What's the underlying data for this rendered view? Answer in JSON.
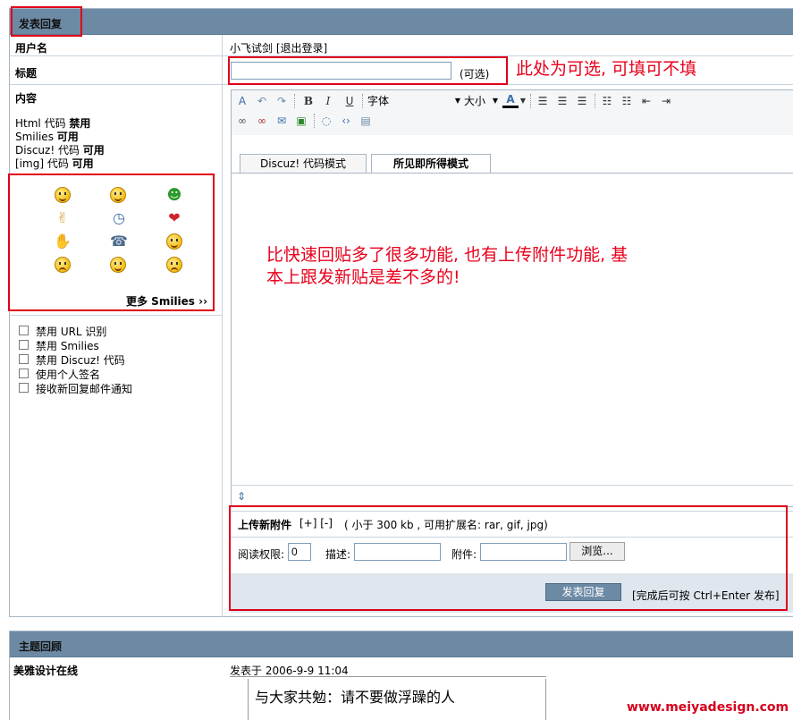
{
  "reply_panel": {
    "title": "发表回复",
    "username_label": "用户名",
    "username_value": "小飞试剑 [退出登录]",
    "subject_label": "标题",
    "subject_value": "",
    "subject_optional": "(可选)",
    "content_label": "内容",
    "codes": [
      {
        "name": "Html 代码",
        "status": "禁用"
      },
      {
        "name": "Smilies",
        "status": "可用"
      },
      {
        "name": "Discuz! 代码",
        "status": "可用"
      },
      {
        "name": "[img] 代码",
        "status": "可用"
      }
    ],
    "smilies_more": "更多 Smilies ››",
    "options": [
      "禁用 URL 识别",
      "禁用 Smilies",
      "禁用 Discuz! 代码",
      "使用个人签名",
      "接收新回复邮件通知"
    ]
  },
  "editor": {
    "font_label": "字体",
    "size_label": "大小",
    "tabs": [
      "Discuz! 代码模式",
      "所见即所得模式"
    ],
    "resize_glyph": "⇕"
  },
  "attachments": {
    "title": "上传新附件",
    "links": "[+] [-]",
    "note": "( 小于 300 kb , 可用扩展名: rar, gif, jpg)",
    "perm_label": "阅读权限:",
    "perm_value": "0",
    "desc_label": "描述:",
    "file_label": "附件:",
    "browse_label": "浏览..."
  },
  "submit": {
    "button_label": "发表回复",
    "hint": "[完成后可按 Ctrl+Enter 发布]"
  },
  "annotations": {
    "subject_note": "此处为可选, 可填可不填",
    "editor_note_line1": "比快速回贴多了很多功能, 也有上传附件功能, 基",
    "editor_note_line2": "本上跟发新贴是差不多的!"
  },
  "review_panel": {
    "title": "主题回顾",
    "author": "美雅设计在线",
    "posted": "发表于 2006-9-9 11:04",
    "post_text": "与大家共勉：请不要做浮躁的人"
  },
  "watermark": "www.meiyadesign.com",
  "colors": {
    "header_bg": "#6d8aa5",
    "annotation_red": "#e8001c",
    "watermark_red": "#d6001c"
  }
}
